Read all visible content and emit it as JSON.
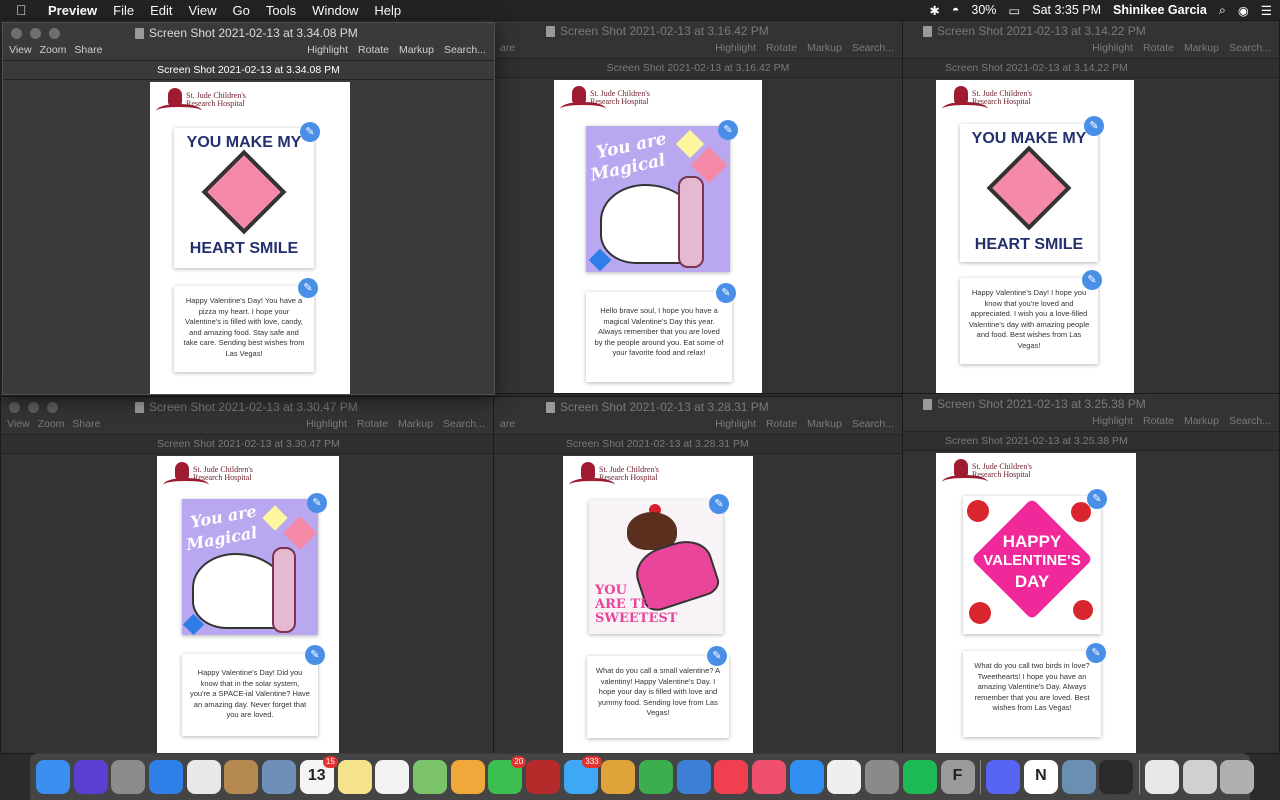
{
  "menubar": {
    "apple_icon": "apple-icon",
    "app": "Preview",
    "menus": [
      "File",
      "Edit",
      "View",
      "Go",
      "Tools",
      "Window",
      "Help"
    ],
    "battery": "30%",
    "clock": "Sat 3:35 PM",
    "user": "Shinikee Garcia"
  },
  "toolbar": {
    "view": "View",
    "zoom": "Zoom",
    "share": "Share",
    "highlight": "Highlight",
    "rotate": "Rotate",
    "markup": "Markup",
    "search": "Search...",
    "search_cut": "Search...",
    "share_cut": "are"
  },
  "logo": {
    "line1": "St. Jude Children's",
    "line2": "Research Hospital"
  },
  "cards": {
    "heart_top": "YOU MAKE MY",
    "heart_bottom": "HEART SMILE",
    "magic1": "You are",
    "magic2": "Magical",
    "sweet1": "YOU",
    "sweet2": "ARE THE",
    "sweet3": "SWEETEST",
    "val1": "HAPPY",
    "val2": "VALENTINE'S",
    "val3": "DAY"
  },
  "windows": [
    {
      "title": "Screen Shot 2021-02-13 at 3.34.08 PM",
      "subtitle": "Screen Shot 2021-02-13 at 3.34.08 PM",
      "message": "Happy Valentine's Day! You have a pizza my heart. I hope your Valentine's is filled with love, candy, and amazing food. Stay safe and take care. Sending best wishes from Las Vegas!"
    },
    {
      "title": "Screen Shot 2021-02-13 at 3.16.42 PM",
      "subtitle": "Screen Shot 2021-02-13 at 3.16.42 PM",
      "message": "Hello brave soul, I hope you have a magical Valentine's Day this year. Always remember that you are loved by the people around you. Eat some of your favorite food and relax!"
    },
    {
      "title": "Screen Shot 2021-02-13 at 3.14.22 PM",
      "subtitle": "Screen Shot 2021-02-13 at 3.14.22 PM",
      "message": "Happy Valentine's Day! I hope you know that you're loved and appreciated. I wish you a love-filled Valentine's day with amazing people and food. Best wishes from Las Vegas!"
    },
    {
      "title": "Screen Shot 2021-02-13 at 3.30.47 PM",
      "subtitle": "Screen Shot 2021-02-13 at 3.30.47 PM",
      "message": "Happy Valentine's Day! Did you know that in the solar system, you're a SPACE-ial Valentine? Have an amazing day. Never forget that you are loved."
    },
    {
      "title": "Screen Shot 2021-02-13 at 3.28.31 PM",
      "subtitle": "Screen Shot 2021-02-13 at 3.28.31 PM",
      "message": "What do you call a small valentine? A valentiny! Happy Valentine's Day. I hope your day is filled with love and yummy food. Sending love from Las Vegas!"
    },
    {
      "title": "Screen Shot 2021-02-13 at 3.25.38 PM",
      "subtitle": "Screen Shot 2021-02-13 at 3.25.38 PM",
      "message": "What do you call two birds in love? Tweethearts! I hope you have an amazing Valentine's Day. Always remember that you are loved. Best wishes from Las Vegas!"
    }
  ],
  "dock": {
    "apps": [
      {
        "icon": "finder-icon",
        "color": "#3b8ff0"
      },
      {
        "icon": "siri-icon",
        "color": "#5a3fd0"
      },
      {
        "icon": "launchpad-icon",
        "color": "#8c8c8c"
      },
      {
        "icon": "safari-icon",
        "color": "#2f7fe8"
      },
      {
        "icon": "chrome-icon",
        "color": "#e8e8e8"
      },
      {
        "icon": "contacts-icon",
        "color": "#b5894f"
      },
      {
        "icon": "preview-icon",
        "color": "#6e8fb8"
      },
      {
        "icon": "calendar-icon",
        "color": "#f5f5f5",
        "label": "13",
        "badge": "15"
      },
      {
        "icon": "notes-icon",
        "color": "#f4e38a"
      },
      {
        "icon": "reminders-icon",
        "color": "#f2f2f2"
      },
      {
        "icon": "maps-icon",
        "color": "#7bc36a"
      },
      {
        "icon": "photos-icon",
        "color": "#f0a83a"
      },
      {
        "icon": "facetime-icon",
        "color": "#3dbf4f",
        "badge": "20"
      },
      {
        "icon": "photo-booth-icon",
        "color": "#b52a2a"
      },
      {
        "icon": "messages-icon",
        "color": "#3fa8f4",
        "badge": "333"
      },
      {
        "icon": "photo-slideshow-icon",
        "color": "#e0a33a"
      },
      {
        "icon": "numbers-icon",
        "color": "#3cae4d"
      },
      {
        "icon": "keynote-icon",
        "color": "#3e7fd6"
      },
      {
        "icon": "news-icon",
        "color": "#f04050"
      },
      {
        "icon": "music-icon",
        "color": "#f0506e"
      },
      {
        "icon": "app-store-icon",
        "color": "#2f8ef0"
      },
      {
        "icon": "textedit-icon",
        "color": "#efefef"
      },
      {
        "icon": "system-preferences-icon",
        "color": "#8a8a8a"
      },
      {
        "icon": "spotify-icon",
        "color": "#1db954"
      },
      {
        "icon": "font-book-icon",
        "color": "#9a9a9a",
        "label": "F"
      },
      {
        "icon": "discord-icon",
        "color": "#5865f2"
      },
      {
        "icon": "notion-icon",
        "color": "#ffffff",
        "label": "N"
      },
      {
        "icon": "preview-doc-icon",
        "color": "#6a8fb0"
      },
      {
        "icon": "screenshot-thumb-icon",
        "color": "#2a2a2a"
      },
      {
        "icon": "document-icon",
        "color": "#e8e8e8"
      },
      {
        "icon": "downloads-stack-icon",
        "color": "#d0d0d0"
      },
      {
        "icon": "trash-icon",
        "color": "#b0b0b0"
      }
    ]
  }
}
